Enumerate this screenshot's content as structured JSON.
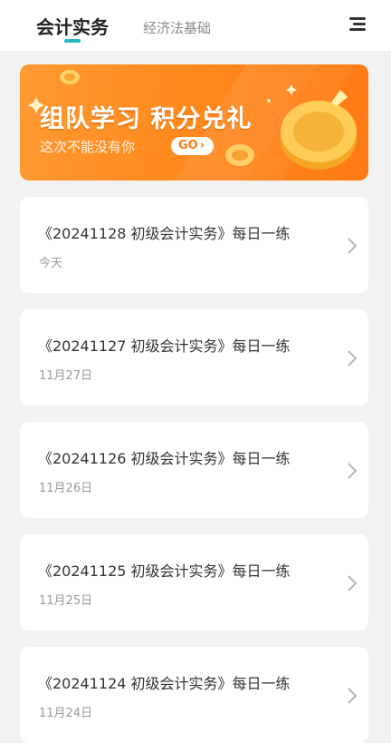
{
  "header": {
    "tabs": [
      {
        "label": "会计实务",
        "active": true
      },
      {
        "label": "经济法基础",
        "active": false
      }
    ],
    "menu_icon": "menu-icon"
  },
  "banner": {
    "title": "组队学习 积分兑礼",
    "subtitle": "这次不能没有你",
    "go_label": "GO",
    "colors": {
      "start": "#ff9a33",
      "end": "#ff7a14"
    }
  },
  "list": {
    "items": [
      {
        "title": "《20241128 初级会计实务》每日一练",
        "date": "今天"
      },
      {
        "title": "《20241127 初级会计实务》每日一练",
        "date": "11月27日"
      },
      {
        "title": "《20241126 初级会计实务》每日一练",
        "date": "11月26日"
      },
      {
        "title": "《20241125 初级会计实务》每日一练",
        "date": "11月25日"
      },
      {
        "title": "《20241124 初级会计实务》每日一练",
        "date": "11月24日"
      }
    ]
  },
  "colors": {
    "accent": "#2bb3c0",
    "background": "#f2f2f3"
  }
}
